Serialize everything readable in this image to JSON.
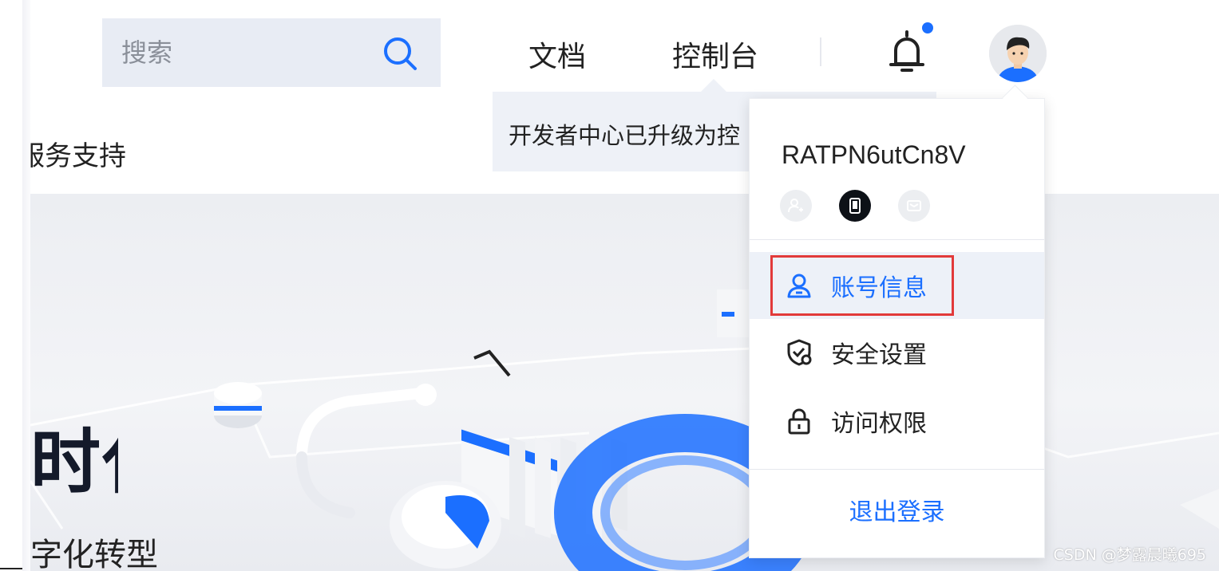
{
  "search": {
    "placeholder": "搜索"
  },
  "nav": {
    "docs_label": "文档",
    "console_label": "控制台"
  },
  "notification": {
    "has_unread": true,
    "dot_color": "#1b6fff"
  },
  "banner": {
    "text": "开发者中心已升级为控"
  },
  "services_label": "服务支持",
  "hero": {
    "title": "时代",
    "subtitle": "字化转型"
  },
  "user_menu": {
    "username": "RATPN6utCn8V",
    "badges": [
      {
        "icon": "realname-verify-icon",
        "state": "inactive"
      },
      {
        "icon": "phone-bound-icon",
        "state": "active"
      },
      {
        "icon": "email-bound-icon",
        "state": "inactive"
      }
    ],
    "items": [
      {
        "label": "账号信息",
        "icon": "user-icon",
        "active": true
      },
      {
        "label": "安全设置",
        "icon": "shield-gear-icon",
        "active": false
      },
      {
        "label": "访问权限",
        "icon": "lock-icon",
        "active": false
      }
    ],
    "logout_label": "退出登录"
  },
  "watermark": "CSDN @梦露晨曦695",
  "colors": {
    "accent": "#1b6fff",
    "highlight": "#e23a3a"
  }
}
